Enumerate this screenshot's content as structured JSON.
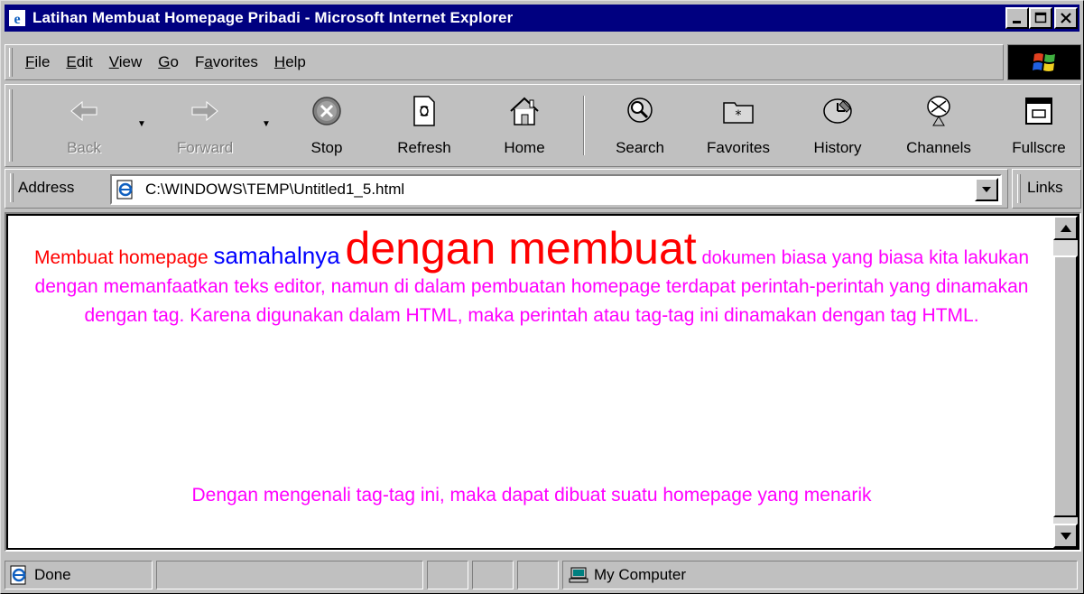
{
  "window": {
    "title": "Latihan Membuat Homepage Pribadi - Microsoft Internet Explorer",
    "controls": {
      "minimize": "_",
      "maximize": "□",
      "close": "×"
    }
  },
  "menu": [
    {
      "label": "File",
      "underline": "F",
      "rest": "ile"
    },
    {
      "label": "Edit",
      "underline": "E",
      "rest": "dit"
    },
    {
      "label": "View",
      "underline": "V",
      "rest": "iew"
    },
    {
      "label": "Go",
      "underline": "G",
      "rest": "o"
    },
    {
      "label": "Favorites",
      "pre": "F",
      "underline": "a",
      "rest": "vorites"
    },
    {
      "label": "Help",
      "underline": "H",
      "rest": "elp"
    }
  ],
  "toolbar": {
    "back": "Back",
    "forward": "Forward",
    "stop": "Stop",
    "refresh": "Refresh",
    "home": "Home",
    "search": "Search",
    "favorites": "Favorites",
    "history": "History",
    "channels": "Channels",
    "fullscreen": "Fullscre"
  },
  "address": {
    "label": "Address",
    "value": "C:\\WINDOWS\\TEMP\\Untitled1_5.html"
  },
  "links": {
    "label": "Links"
  },
  "page": {
    "p1_red": "Membuat homepage",
    "p1_blue": "samahalnya",
    "p1_big": "dengan membuat",
    "p1_mag": "dokumen",
    "p1_rest": "biasa yang biasa kita lakukan dengan memanfaatkan teks editor, namun di dalam pembuatan homepage terdapat perintah-perintah yang dinamakan dengan tag. Karena digunakan dalam HTML, maka perintah atau tag-tag ini dinamakan dengan tag HTML.",
    "p2": "Dengan mengenali tag-tag ini, maka dapat dibuat suatu homepage yang menarik"
  },
  "status": {
    "text": "Done",
    "zone": "My Computer"
  },
  "colors": {
    "titlebar": "#000080",
    "red": "#ff0000",
    "blue": "#0000ff",
    "magenta": "#ff00ff"
  }
}
